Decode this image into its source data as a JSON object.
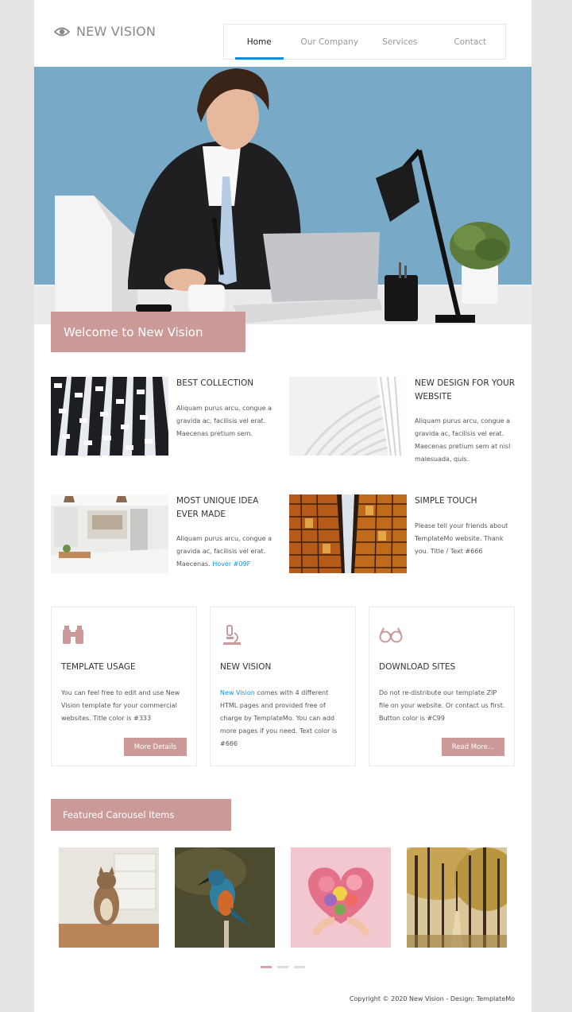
{
  "header": {
    "logo_text": "NEW VISION",
    "nav": [
      "Home",
      "Our Company",
      "Services",
      "Contact"
    ],
    "active_nav": "Home"
  },
  "hero": {
    "banner": "Welcome to New Vision"
  },
  "features": [
    {
      "title": "BEST COLLECTION",
      "text": "Aliquam purus arcu, congue a gravida ac, facilisis vel erat. Maecenas pretium sem."
    },
    {
      "title": "NEW DESIGN FOR YOUR WEBSITE",
      "text": "Aliquam purus arcu, congue a gravida ac, facilisis vel erat. Maecenas pretium sem at nisl malesuada, quis."
    },
    {
      "title": "MOST UNIQUE IDEA EVER MADE",
      "text": "Aliquam purus arcu, congue a gravida ac, facilisis vel erat. Maecenas.",
      "link": "Hover #09F"
    },
    {
      "title": "SIMPLE TOUCH",
      "text": "Please tell your friends about TemplateMo website. Thank you. Title / Text #666"
    }
  ],
  "cards": [
    {
      "icon": "binoculars-icon",
      "title": "TEMPLATE USAGE",
      "text": "You can feel free to edit and use New Vision template for your commercial websites. Title color is #333",
      "button": "More Details"
    },
    {
      "icon": "microscope-icon",
      "title": "NEW VISION",
      "link": "New Vision",
      "text": " comes with 4 different HTML pages and provided free of charge by TemplateMo. You can add more pages if you need. Text color is #666"
    },
    {
      "icon": "glasses-icon",
      "title": "DOWNLOAD SITES",
      "text": "Do not re-distribute our template ZIP file on your website. Or contact us first. Button color is #C99",
      "button": "Read More..."
    }
  ],
  "carousel": {
    "title": "Featured Carousel Items",
    "items": [
      "cat-photo",
      "kingfisher-photo",
      "flower-heart-photo",
      "autumn-forest-photo"
    ],
    "active_dot": 1
  },
  "footer": {
    "copyright": "Copyright © 2020 New Vision - Design: TemplateMo"
  },
  "colors": {
    "accent": "#cc9999",
    "link": "#0099ff",
    "nav_active": "#0a8fe0",
    "title": "#333333",
    "text": "#666666"
  }
}
